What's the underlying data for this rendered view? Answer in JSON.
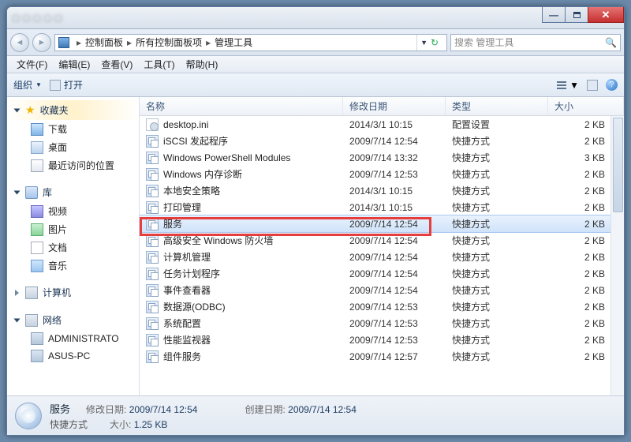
{
  "titlebar": {
    "min": "min",
    "max": "max",
    "close": "close"
  },
  "breadcrumb": {
    "items": [
      "控制面板",
      "所有控制面板项",
      "管理工具"
    ]
  },
  "search": {
    "placeholder": "搜索 管理工具"
  },
  "menubar": {
    "file": "文件(F)",
    "edit": "编辑(E)",
    "view": "查看(V)",
    "tools": "工具(T)",
    "help": "帮助(H)"
  },
  "toolbar": {
    "organize": "组织",
    "open": "打开"
  },
  "sidebar": {
    "favorites": {
      "label": "收藏夹",
      "items": [
        {
          "icon": "dl",
          "label": "下载"
        },
        {
          "icon": "desk",
          "label": "桌面"
        },
        {
          "icon": "rec",
          "label": "最近访问的位置"
        }
      ]
    },
    "libraries": {
      "label": "库",
      "items": [
        {
          "icon": "vid",
          "label": "视频"
        },
        {
          "icon": "pic",
          "label": "图片"
        },
        {
          "icon": "doc",
          "label": "文档"
        },
        {
          "icon": "mus",
          "label": "音乐"
        }
      ]
    },
    "computer": {
      "label": "计算机"
    },
    "network": {
      "label": "网络",
      "items": [
        {
          "icon": "mon",
          "label": "ADMINISTRATO"
        },
        {
          "icon": "mon",
          "label": "ASUS-PC"
        }
      ]
    }
  },
  "columns": {
    "name": "名称",
    "date": "修改日期",
    "type": "类型",
    "size": "大小"
  },
  "rows": [
    {
      "icon": "ini",
      "name": "desktop.ini",
      "date": "2014/3/1 10:15",
      "type": "配置设置",
      "size": "2 KB"
    },
    {
      "icon": "lnk",
      "name": "iSCSI 发起程序",
      "date": "2009/7/14 12:54",
      "type": "快捷方式",
      "size": "2 KB"
    },
    {
      "icon": "lnk",
      "name": "Windows PowerShell Modules",
      "date": "2009/7/14 13:32",
      "type": "快捷方式",
      "size": "3 KB"
    },
    {
      "icon": "lnk",
      "name": "Windows 内存诊断",
      "date": "2009/7/14 12:53",
      "type": "快捷方式",
      "size": "2 KB"
    },
    {
      "icon": "lnk",
      "name": "本地安全策略",
      "date": "2014/3/1 10:15",
      "type": "快捷方式",
      "size": "2 KB"
    },
    {
      "icon": "lnk",
      "name": "打印管理",
      "date": "2014/3/1 10:15",
      "type": "快捷方式",
      "size": "2 KB"
    },
    {
      "icon": "lnk",
      "name": "服务",
      "date": "2009/7/14 12:54",
      "type": "快捷方式",
      "size": "2 KB",
      "selected": true
    },
    {
      "icon": "lnk",
      "name": "高级安全 Windows 防火墙",
      "date": "2009/7/14 12:54",
      "type": "快捷方式",
      "size": "2 KB"
    },
    {
      "icon": "lnk",
      "name": "计算机管理",
      "date": "2009/7/14 12:54",
      "type": "快捷方式",
      "size": "2 KB"
    },
    {
      "icon": "lnk",
      "name": "任务计划程序",
      "date": "2009/7/14 12:54",
      "type": "快捷方式",
      "size": "2 KB"
    },
    {
      "icon": "lnk",
      "name": "事件查看器",
      "date": "2009/7/14 12:54",
      "type": "快捷方式",
      "size": "2 KB"
    },
    {
      "icon": "lnk",
      "name": "数据源(ODBC)",
      "date": "2009/7/14 12:53",
      "type": "快捷方式",
      "size": "2 KB"
    },
    {
      "icon": "lnk",
      "name": "系统配置",
      "date": "2009/7/14 12:53",
      "type": "快捷方式",
      "size": "2 KB"
    },
    {
      "icon": "lnk",
      "name": "性能监视器",
      "date": "2009/7/14 12:53",
      "type": "快捷方式",
      "size": "2 KB"
    },
    {
      "icon": "lnk",
      "name": "组件服务",
      "date": "2009/7/14 12:57",
      "type": "快捷方式",
      "size": "2 KB"
    }
  ],
  "status": {
    "title": "服务",
    "type_label": "快捷方式",
    "mod_label": "修改日期:",
    "mod_val": "2009/7/14 12:54",
    "crt_label": "创建日期:",
    "crt_val": "2009/7/14 12:54",
    "size_label": "大小:",
    "size_val": "1.25 KB"
  }
}
